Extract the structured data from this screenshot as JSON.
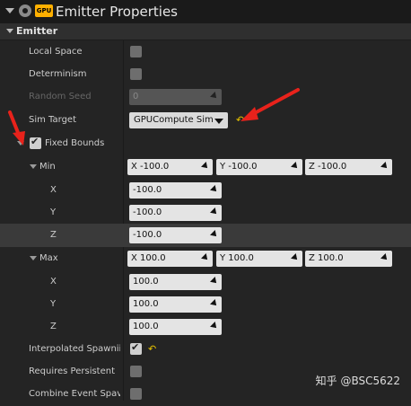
{
  "header": {
    "title": "Emitter Properties",
    "gpu_badge": "GPU",
    "gear_icon": "gear-icon"
  },
  "category": {
    "label": "Emitter"
  },
  "rows": {
    "local_space": {
      "label": "Local Space",
      "checked": false
    },
    "determinism": {
      "label": "Determinism",
      "checked": false
    },
    "random_seed": {
      "label": "Random Seed",
      "value": "0"
    },
    "sim_target": {
      "label": "Sim Target",
      "value": "GPUCompute Sim"
    },
    "fixed_bounds": {
      "label": "Fixed Bounds",
      "checked": true
    },
    "min": {
      "label": "Min",
      "x_label": "X",
      "y_label": "Y",
      "z_label": "Z",
      "x_inline": "X  -100.0",
      "y_inline": "Y  -100.0",
      "z_inline": "Z  -100.0",
      "x": "-100.0",
      "y": "-100.0",
      "z": "-100.0"
    },
    "max": {
      "label": "Max",
      "x_label": "X",
      "y_label": "Y",
      "z_label": "Z",
      "x_inline": "X  100.0",
      "y_inline": "Y  100.0",
      "z_inline": "Z  100.0",
      "x": "100.0",
      "y": "100.0",
      "z": "100.0"
    },
    "interpolated_spawning": {
      "label": "Interpolated Spawnii",
      "checked": true
    },
    "requires_persistent": {
      "label": "Requires Persistent",
      "checked": false
    },
    "combine_event_spawn": {
      "label": "Combine Event Spav",
      "checked": false
    }
  },
  "watermark": "知乎 @BSC5622",
  "colors": {
    "accent_arrow": "#e8221b",
    "reset_arrow": "#e8c300",
    "panel_bg": "#242424"
  }
}
